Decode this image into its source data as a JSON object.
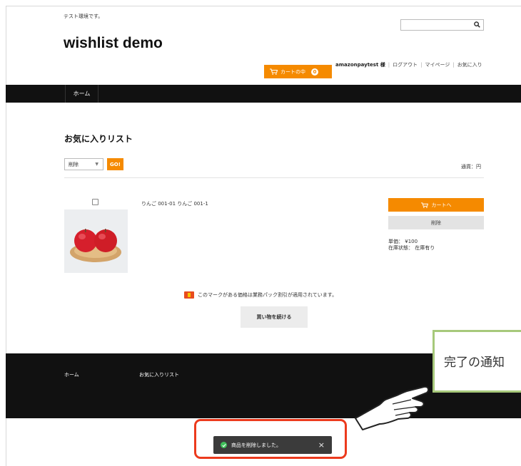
{
  "header": {
    "tagline": "テスト環境です。",
    "site_title": "wishlist demo",
    "search_placeholder": "",
    "cart_label": "カートの中",
    "cart_count": "0",
    "user_name": "amazonpaytest 様",
    "links": [
      "ログアウト",
      "マイページ",
      "お気に入り"
    ]
  },
  "nav": {
    "home": "ホーム"
  },
  "main": {
    "heading": "お気に入りリスト",
    "action_select": "削除",
    "go_label": "GO!",
    "currency": "通貨：円",
    "item": {
      "name": "りんご 001-01 りんご 001-1",
      "to_cart": "カートへ",
      "delete": "削除",
      "price_label": "単価：",
      "price": "¥100",
      "stock_label": "在庫状態：",
      "stock": "在庫有り"
    },
    "notice": "このマークがある価格は業務パック割引が適用されています。",
    "continue": "買い物を続ける"
  },
  "footer": {
    "home": "ホーム",
    "favorites": "お気に入りリスト"
  },
  "callout": {
    "text": "完了の通知"
  },
  "toast": {
    "message": "商品を削除しました。",
    "close": "×"
  },
  "colors": {
    "accent": "#f58a00",
    "highlight": "#ec3a1d",
    "callout_border": "#a7c97b"
  }
}
